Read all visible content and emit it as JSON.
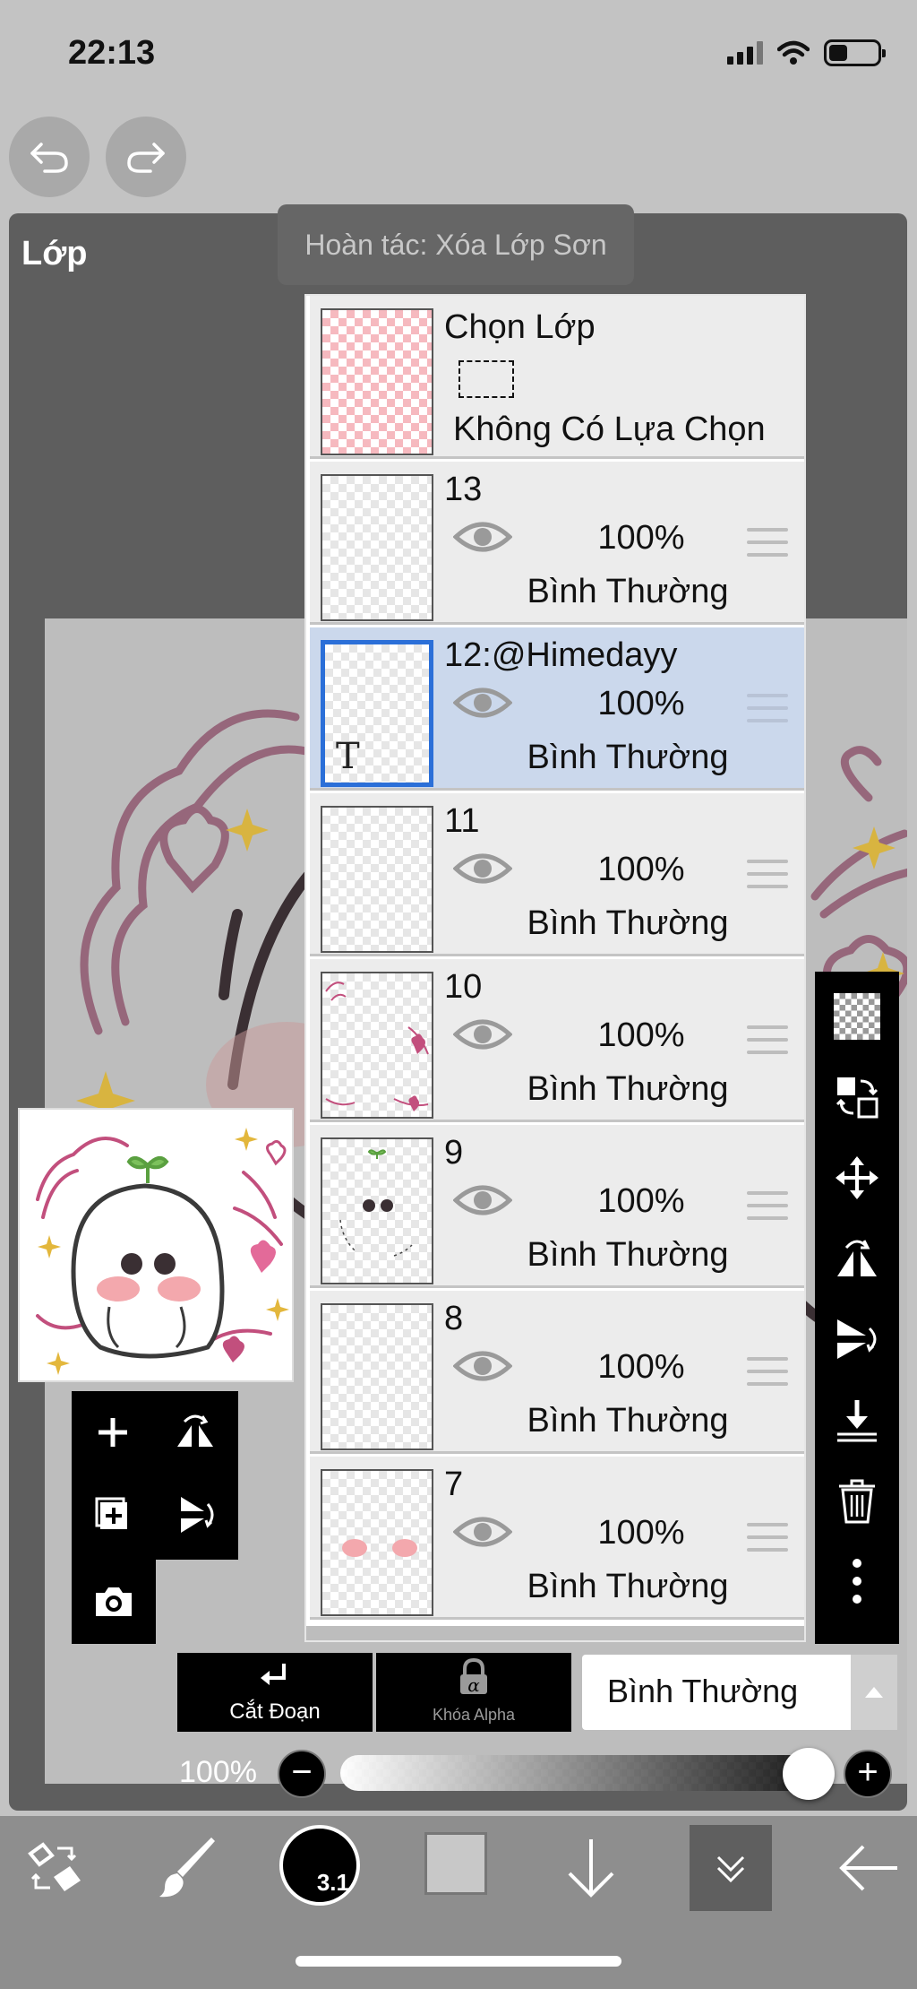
{
  "status": {
    "time": "22:13"
  },
  "panel": {
    "title": "Lớp"
  },
  "toast": {
    "text": "Hoàn tác: Xóa Lớp Sơn"
  },
  "selection_layer": {
    "title": "Chọn Lớp",
    "state": "Không Có Lựa Chọn"
  },
  "layers": [
    {
      "name": "13",
      "opacity": "100%",
      "blend": "Bình Thường",
      "selected": false
    },
    {
      "name": "12:@Himedayy",
      "opacity": "100%",
      "blend": "Bình Thường",
      "selected": true,
      "thumb_text": "T"
    },
    {
      "name": "11",
      "opacity": "100%",
      "blend": "Bình Thường",
      "selected": false
    },
    {
      "name": "10",
      "opacity": "100%",
      "blend": "Bình Thường",
      "selected": false
    },
    {
      "name": "9",
      "opacity": "100%",
      "blend": "Bình Thường",
      "selected": false
    },
    {
      "name": "8",
      "opacity": "100%",
      "blend": "Bình Thường",
      "selected": false
    },
    {
      "name": "7",
      "opacity": "100%",
      "blend": "Bình Thường",
      "selected": false
    }
  ],
  "controls": {
    "clipping_label": "Cắt Đoạn",
    "alpha_lock_label": "Khóa Alpha",
    "alpha_lock_glyph": "α",
    "blend_mode": "Bình Thường",
    "opacity_label": "100%",
    "opacity_value": 1.0
  },
  "toolbar": {
    "brush_size": "3.1"
  },
  "colors": {
    "accent_selection": "#2b6fd8",
    "selected_row": "#cbd8ec",
    "current_color": "#c8c8c8"
  },
  "icons": {
    "top": [
      "undo-icon",
      "redo-icon"
    ],
    "right_tools": [
      "checker-new-layer-icon",
      "layer-swap-icon",
      "move-icon",
      "flip-horizontal-icon",
      "flip-vertical-icon",
      "merge-down-icon",
      "trash-icon",
      "more-icon"
    ],
    "left_tools": [
      "plus-icon",
      "flip-horizontal-icon",
      "duplicate-layer-icon",
      "flip-vertical-icon",
      "camera-icon"
    ],
    "bottom_bar": [
      "transform-icon",
      "brush-icon",
      "brush-size-icon",
      "color-swatch-icon",
      "arrow-down-icon",
      "layers-collapse-icon",
      "back-icon"
    ]
  }
}
